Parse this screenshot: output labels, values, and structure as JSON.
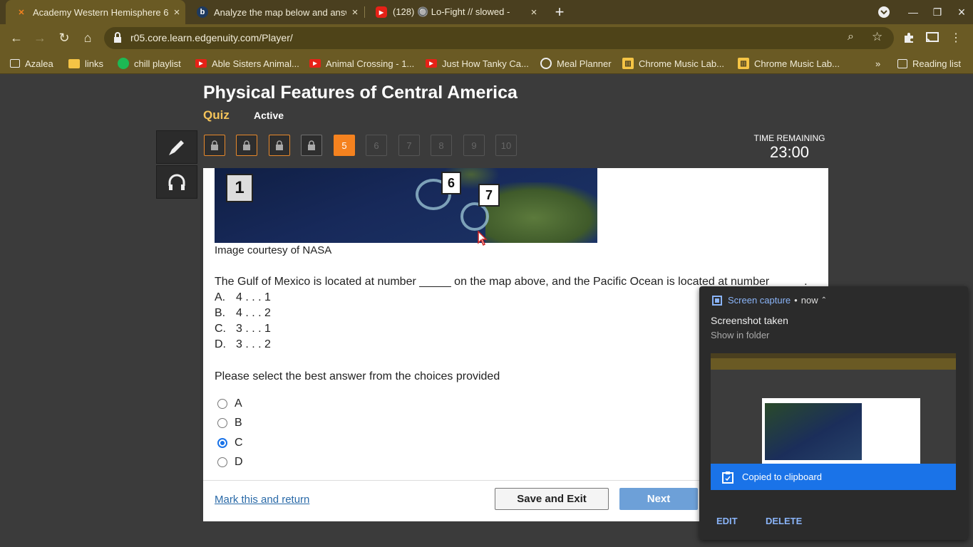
{
  "browser": {
    "tabs": [
      {
        "title": "Academy Western Hemisphere 6",
        "icon": "edgenuity-icon",
        "active": true
      },
      {
        "title": "Analyze the map below and answ",
        "icon": "brainly-icon",
        "active": false
      },
      {
        "title": "(128) 🔘 Lo-Fight // slowed -",
        "icon": "youtube-icon",
        "active": false
      }
    ],
    "url": "r05.core.learn.edgenuity.com/Player/",
    "bookmarks": [
      {
        "label": "Azalea",
        "icon": "folder-icon"
      },
      {
        "label": "links",
        "icon": "folder-icon"
      },
      {
        "label": "chill playlist",
        "icon": "spotify-icon"
      },
      {
        "label": "Able Sisters Animal...",
        "icon": "youtube-icon"
      },
      {
        "label": "Animal Crossing - 1...",
        "icon": "youtube-icon"
      },
      {
        "label": "Just How Tanky Ca...",
        "icon": "youtube-icon"
      },
      {
        "label": "Meal Planner",
        "icon": "globe-icon"
      },
      {
        "label": "Chrome Music Lab...",
        "icon": "music-lab-icon"
      },
      {
        "label": "Chrome Music Lab...",
        "icon": "music-lab-icon"
      }
    ],
    "more_bookmarks": "»",
    "reading_list": "Reading list"
  },
  "lesson": {
    "title": "Physical Features of Central America",
    "type": "Quiz",
    "status": "Active",
    "question_nav": [
      "",
      "",
      "",
      "",
      "5",
      "6",
      "7",
      "8",
      "9",
      "10"
    ],
    "current_question": 5,
    "time_label": "TIME REMAINING",
    "time_value": "23:00"
  },
  "question": {
    "map_labels": [
      "1",
      "6",
      "7"
    ],
    "caption": "Image courtesy of NASA",
    "text": "The Gulf of Mexico is located at number _____ on the map above, and the Pacific Ocean is located at number _____.",
    "options": [
      {
        "letter": "A.",
        "text": "4 . . . 1"
      },
      {
        "letter": "B.",
        "text": "4 . . . 2"
      },
      {
        "letter": "C.",
        "text": "3 . . . 1"
      },
      {
        "letter": "D.",
        "text": "3 . . . 2"
      }
    ],
    "instruction": "Please select the best answer from the choices provided",
    "choices": [
      "A",
      "B",
      "C",
      "D"
    ],
    "selected": "C"
  },
  "footer": {
    "mark_label": "Mark this and return",
    "save_label": "Save and Exit",
    "next_label": "Next"
  },
  "notification": {
    "app": "Screen capture",
    "dot": "•",
    "time": "now",
    "title": "Screenshot taken",
    "subtitle": "Show in folder",
    "clipboard": "Copied to clipboard",
    "edit": "EDIT",
    "delete": "DELETE"
  },
  "colors": {
    "accent_orange": "#f5821f",
    "link_blue": "#2a6aa8",
    "notif_blue": "#1a73e8"
  }
}
